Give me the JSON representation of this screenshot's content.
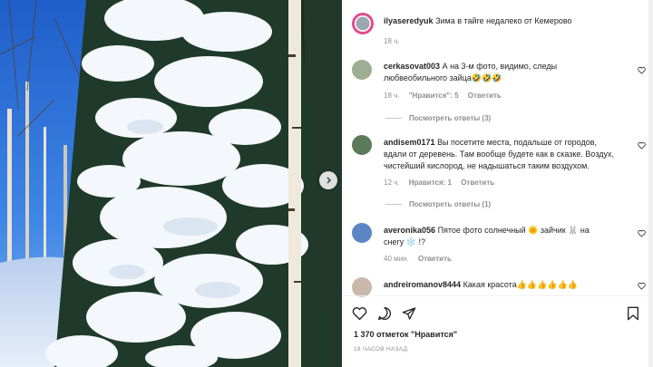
{
  "post": {
    "author": "ilyaseredyuk",
    "caption": "Зима в тайге недалеко от Кемерово",
    "time": "18 ч."
  },
  "comments": [
    {
      "username": "cerkasovat003",
      "text_line1": "А на 3-м фото, видимо, следы",
      "text_line2": "любвеобильного зайца🤣🤣🤣",
      "time": "18 ч.",
      "likes": "\"Нравится\": 5",
      "reply": "Ответить",
      "view_replies": "Посмотреть ответы (3)"
    },
    {
      "username": "andisem0171",
      "text_line1": "Вы посетите места, подальше от городов,",
      "text_line2": "вдали от деревень. Там вообще будете как в сказке. Воздух,",
      "text_line3": "чистейший кислород, не надышаться таким воздухом.",
      "time": "12 ч.",
      "likes": "Нравится: 1",
      "reply": "Ответить",
      "view_replies": "Посмотреть ответы (1)"
    },
    {
      "username": "averonika056",
      "text_line1": "Пятое фото солнечный 🌞 зайчик 🐰 на",
      "text_line2": "снегу ❄️ !?",
      "time": "40 мин.",
      "reply": "Ответить"
    },
    {
      "username": "andreiromanov8444",
      "text_line1": "Какая красота👍👍👍👍👍👍"
    }
  ],
  "footer": {
    "likes": "1 370 отметок \"Нравится\"",
    "ago": "18 ЧАСОВ НАЗАД"
  },
  "icons": {
    "like": "heart-icon",
    "comment": "comment-icon",
    "share": "share-icon",
    "save": "bookmark-icon",
    "next": "chevron-right-icon"
  },
  "colors": {
    "text": "#262626",
    "muted": "#8e8e8e",
    "sky": "#2f6fd6",
    "snow": "#f4f7fb",
    "needle": "#1f3a2a"
  }
}
